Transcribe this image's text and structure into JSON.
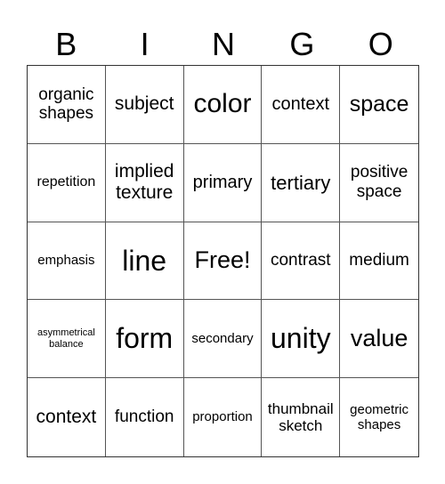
{
  "header": [
    "B",
    "I",
    "N",
    "G",
    "O"
  ],
  "cells": [
    [
      "organic shapes",
      "subject",
      "color",
      "context",
      "space"
    ],
    [
      "repetition",
      "implied texture",
      "primary",
      "tertiary",
      "positive space"
    ],
    [
      "emphasis",
      "line",
      "Free!",
      "contrast",
      "medium"
    ],
    [
      "asymmetrical balance",
      "form",
      "secondary",
      "unity",
      "value"
    ],
    [
      "context",
      "function",
      "proportion",
      "thumbnail sketch",
      "geometric shapes"
    ]
  ]
}
